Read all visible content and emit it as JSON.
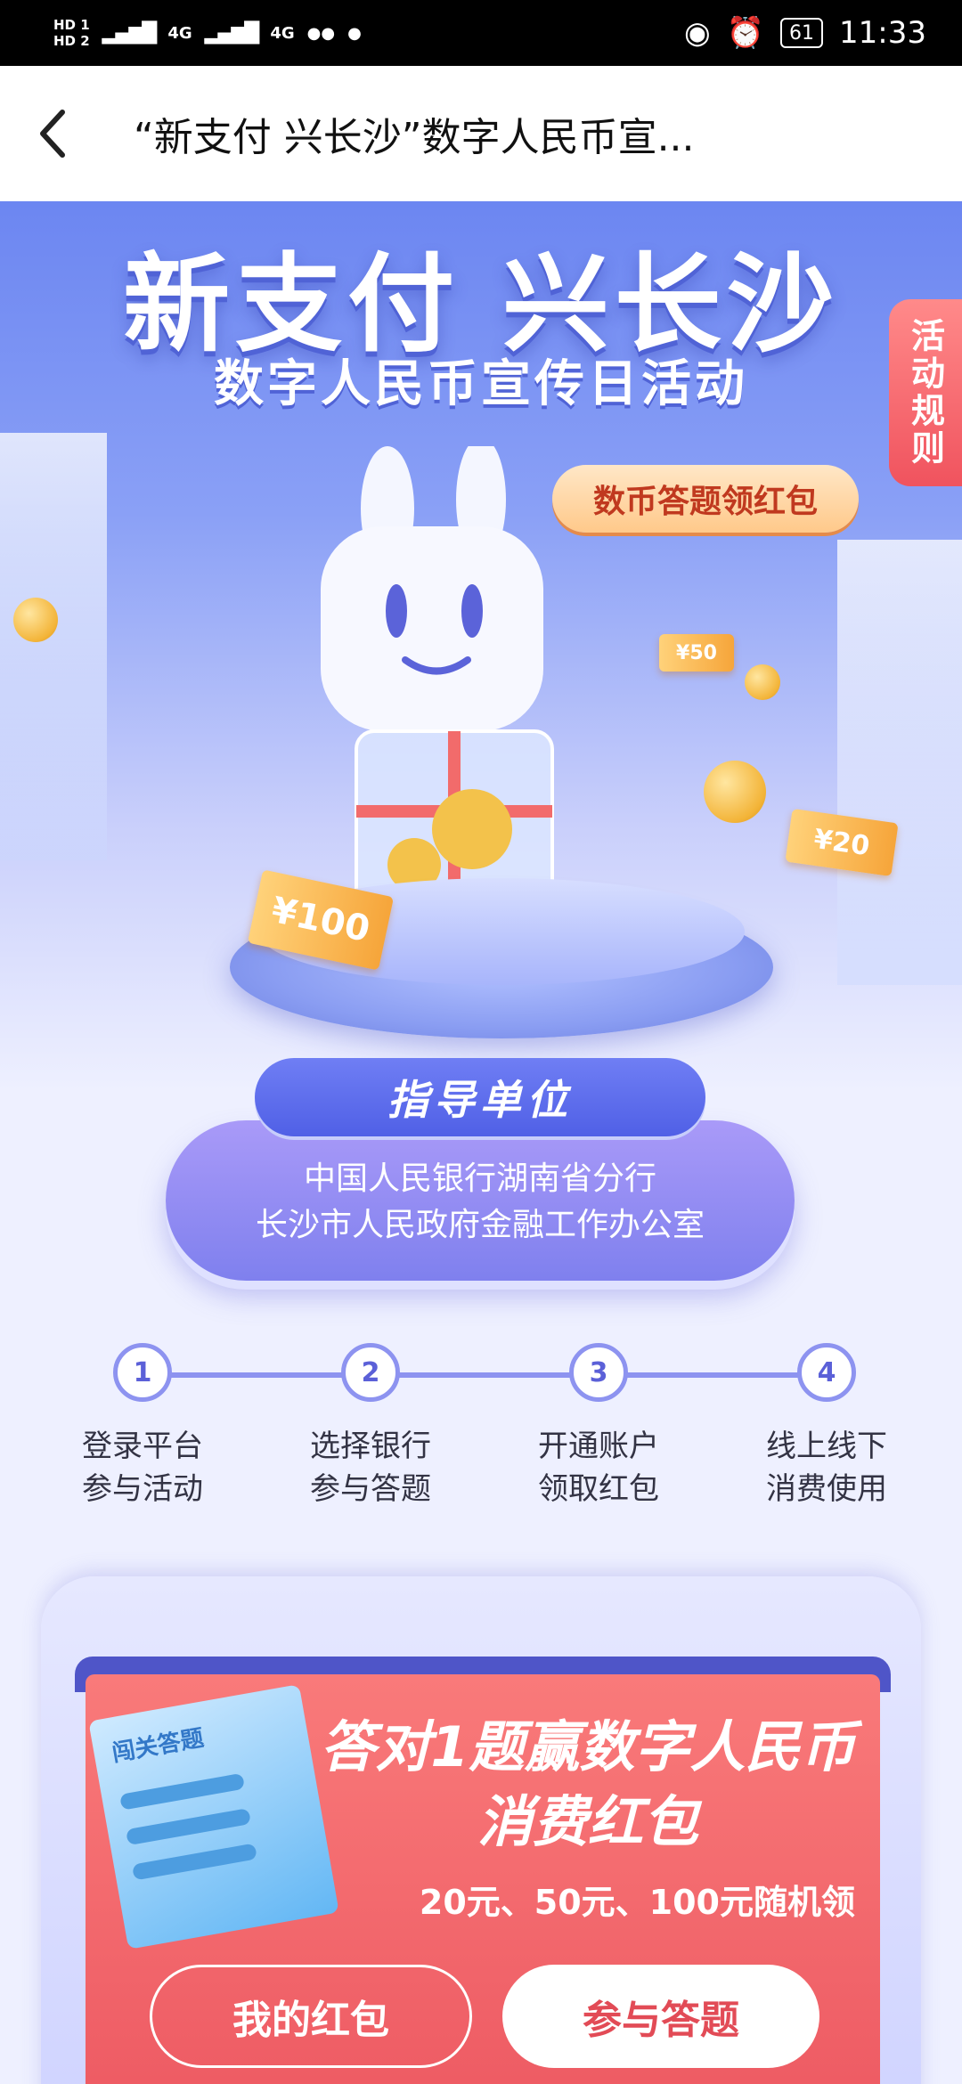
{
  "status_bar": {
    "hd1": "HD 1",
    "hd2": "HD 2",
    "net1": "4G",
    "net2": "4G",
    "battery": "61",
    "time": "11:33"
  },
  "title_bar": {
    "title": "“新支付 兴长沙”数字人民币宣..."
  },
  "hero": {
    "title": "新支付 兴长沙",
    "subtitle": "数字人民币宣传日活动",
    "rules_tab": "活动规则",
    "quiz_bubble": "数币答题领红包",
    "ticket_100": "¥100",
    "ticket_50": "¥50",
    "ticket_20": "¥20"
  },
  "guide": {
    "tab": "指导单位",
    "line1": "中国人民银行湖南省分行",
    "line2": "长沙市人民政府金融工作办公室"
  },
  "steps": [
    {
      "num": "1",
      "line1": "登录平台",
      "line2": "参与活动"
    },
    {
      "num": "2",
      "line1": "选择银行",
      "line2": "参与答题"
    },
    {
      "num": "3",
      "line1": "开通账户",
      "line2": "领取红包"
    },
    {
      "num": "4",
      "line1": "线上线下",
      "line2": "消费使用"
    }
  ],
  "quiz_card": {
    "paper_title": "闯关答题",
    "headline1": "答对1题赢数字人民币",
    "headline2": "消费红包",
    "amounts": "20元、50元、100元随机领",
    "btn_my": "我的红包",
    "btn_join": "参与答题"
  }
}
